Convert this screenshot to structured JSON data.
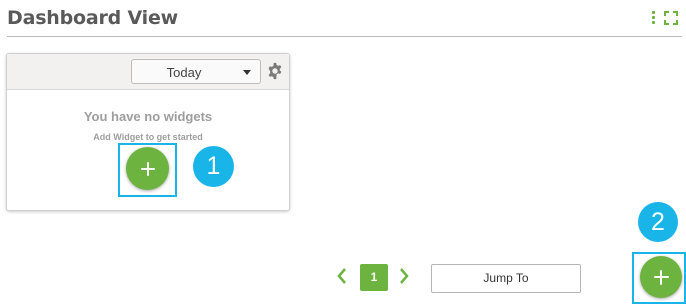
{
  "header": {
    "title": "Dashboard View",
    "menu_icon": "kebab-vertical-icon",
    "fullscreen_icon": "expand-icon"
  },
  "widget_area": {
    "date_range": {
      "selected": "Today"
    },
    "settings_icon": "gear-icon",
    "empty_title": "You have no widgets",
    "empty_subtitle": "Add Widget to get started",
    "add_icon": "plus-icon"
  },
  "callouts": {
    "step1": "1",
    "step2": "2"
  },
  "pagination": {
    "prev_icon": "chevron-left-icon",
    "current_page": "1",
    "next_icon": "chevron-right-icon",
    "jump_label": "Jump To"
  },
  "colors": {
    "accent_green": "#6db33f",
    "callout_blue": "#1ab5e8",
    "title_gray": "#5a5a5a",
    "muted_text": "#9e9e9e"
  }
}
